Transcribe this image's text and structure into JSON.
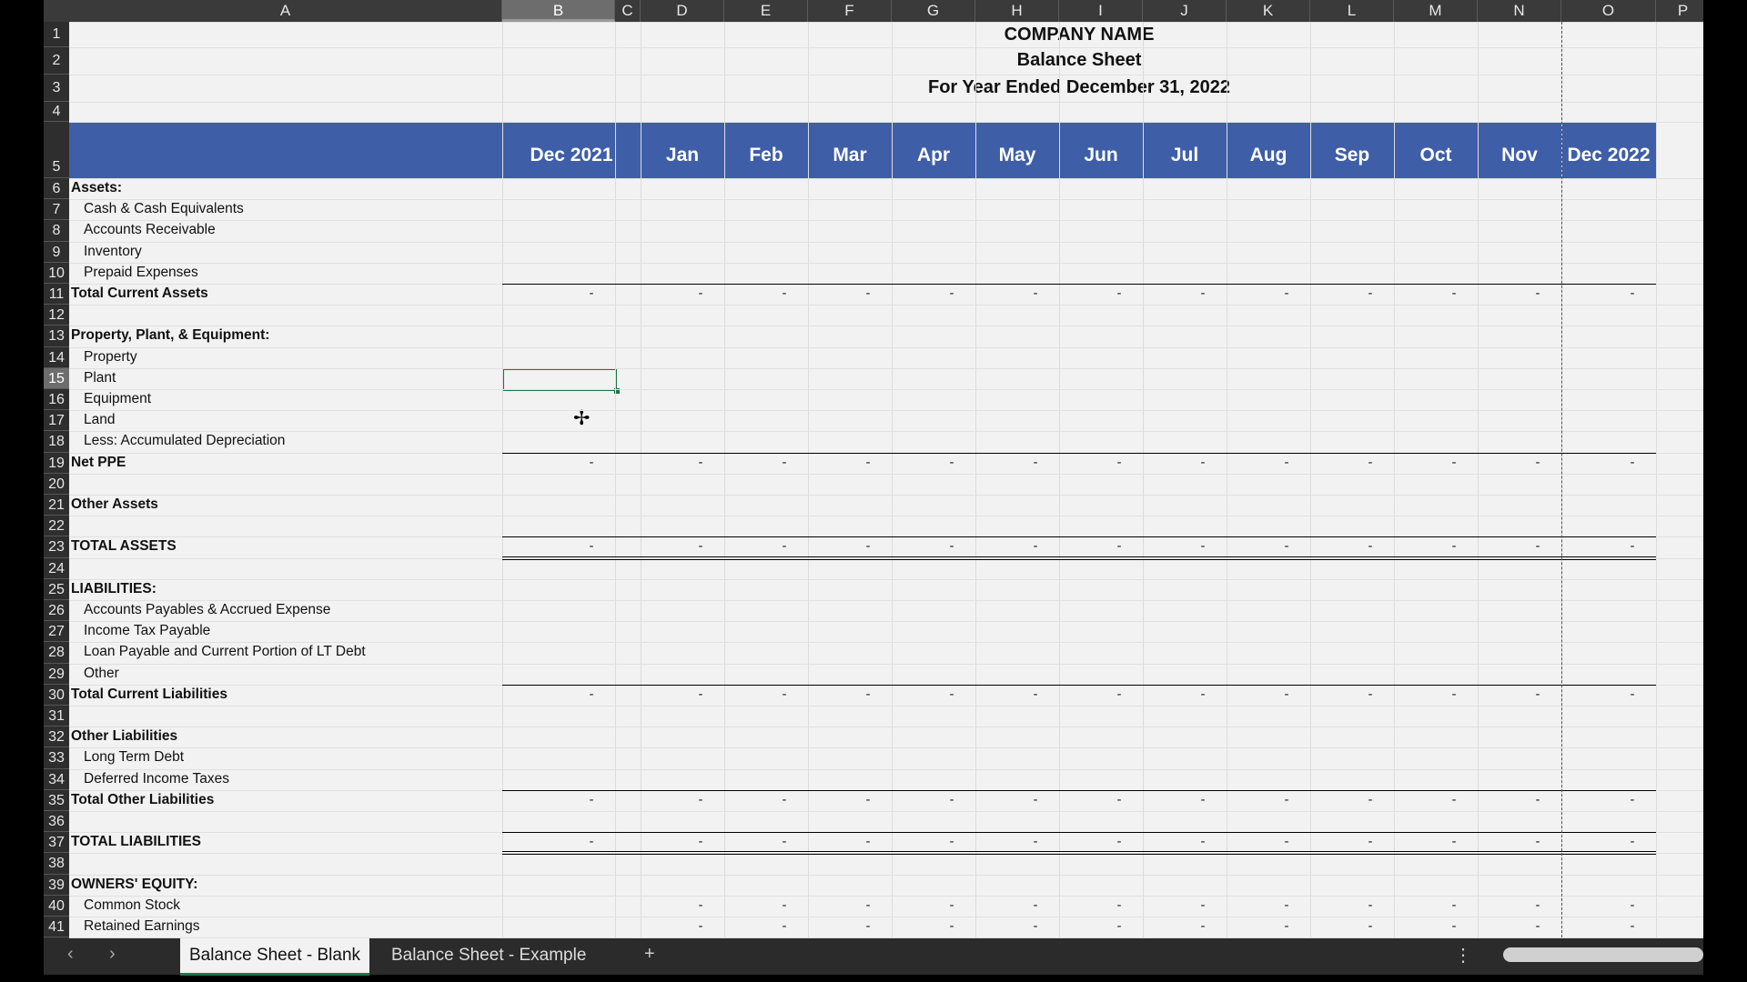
{
  "columns": [
    "A",
    "B",
    "C",
    "D",
    "E",
    "F",
    "G",
    "H",
    "I",
    "J",
    "K",
    "L",
    "M",
    "N",
    "O",
    "P"
  ],
  "selected_column": "B",
  "selected_row": "15",
  "rows": [
    "1",
    "2",
    "3",
    "4",
    "5",
    "6",
    "7",
    "8",
    "9",
    "10",
    "11",
    "12",
    "13",
    "14",
    "15",
    "16",
    "17",
    "18",
    "19",
    "20",
    "21",
    "22",
    "23",
    "24",
    "25",
    "26",
    "27",
    "28",
    "29",
    "30",
    "31",
    "32",
    "33",
    "34",
    "35",
    "36",
    "37",
    "38",
    "39",
    "40",
    "41"
  ],
  "title": {
    "company": "COMPANY NAME",
    "report": "Balance Sheet",
    "period": "For Year Ended December 31, 2022"
  },
  "months": [
    "Dec 2021",
    "Jan",
    "Feb",
    "Mar",
    "Apr",
    "May",
    "Jun",
    "Jul",
    "Aug",
    "Sep",
    "Oct",
    "Nov",
    "Dec 2022"
  ],
  "labels": [
    {
      "row": 6,
      "text": "Assets:",
      "bold": true,
      "indent": false
    },
    {
      "row": 7,
      "text": "Cash & Cash Equivalents",
      "bold": false,
      "indent": true
    },
    {
      "row": 8,
      "text": "Accounts Receivable",
      "bold": false,
      "indent": true
    },
    {
      "row": 9,
      "text": "Inventory",
      "bold": false,
      "indent": true
    },
    {
      "row": 10,
      "text": "Prepaid Expenses",
      "bold": false,
      "indent": true
    },
    {
      "row": 11,
      "text": "Total Current Assets",
      "bold": true,
      "indent": false
    },
    {
      "row": 13,
      "text": "Property, Plant, & Equipment:",
      "bold": true,
      "indent": false
    },
    {
      "row": 14,
      "text": "Property",
      "bold": false,
      "indent": true
    },
    {
      "row": 15,
      "text": "Plant",
      "bold": false,
      "indent": true
    },
    {
      "row": 16,
      "text": "Equipment",
      "bold": false,
      "indent": true
    },
    {
      "row": 17,
      "text": "Land",
      "bold": false,
      "indent": true
    },
    {
      "row": 18,
      "text": "Less:  Accumulated Depreciation",
      "bold": false,
      "indent": true
    },
    {
      "row": 19,
      "text": "Net PPE",
      "bold": true,
      "indent": false
    },
    {
      "row": 21,
      "text": "Other Assets",
      "bold": true,
      "indent": false
    },
    {
      "row": 23,
      "text": "TOTAL ASSETS",
      "bold": true,
      "indent": false
    },
    {
      "row": 25,
      "text": "LIABILITIES:",
      "bold": true,
      "indent": false
    },
    {
      "row": 26,
      "text": "Accounts Payables & Accrued Expense",
      "bold": false,
      "indent": true
    },
    {
      "row": 27,
      "text": "Income Tax Payable",
      "bold": false,
      "indent": true
    },
    {
      "row": 28,
      "text": "Loan Payable and Current Portion of LT Debt",
      "bold": false,
      "indent": true
    },
    {
      "row": 29,
      "text": "Other",
      "bold": false,
      "indent": true
    },
    {
      "row": 30,
      "text": "Total Current Liabilities",
      "bold": true,
      "indent": false
    },
    {
      "row": 32,
      "text": "Other Liabilities",
      "bold": true,
      "indent": false
    },
    {
      "row": 33,
      "text": "Long Term Debt",
      "bold": false,
      "indent": true
    },
    {
      "row": 34,
      "text": "Deferred Income Taxes",
      "bold": false,
      "indent": true
    },
    {
      "row": 35,
      "text": "Total Other Liabilities",
      "bold": true,
      "indent": false
    },
    {
      "row": 37,
      "text": "TOTAL LIABILITIES",
      "bold": true,
      "indent": false
    },
    {
      "row": 39,
      "text": "OWNERS' EQUITY:",
      "bold": true,
      "indent": false
    },
    {
      "row": 40,
      "text": "Common Stock",
      "bold": false,
      "indent": true
    },
    {
      "row": 41,
      "text": "Retained Earnings",
      "bold": false,
      "indent": true
    }
  ],
  "total_rows": [
    11,
    19,
    23,
    30,
    35,
    37
  ],
  "double_rule_rows": [
    23,
    37
  ],
  "equity_rows": [
    40,
    41
  ],
  "empty_value": "-",
  "tabs": {
    "active": "Balance Sheet - Blank",
    "other": "Balance Sheet - Example",
    "add": "+",
    "prev": "‹",
    "next": "›",
    "more": "⋮"
  },
  "colors": {
    "header_band": "#3f5ea8",
    "selection": "#217346"
  }
}
